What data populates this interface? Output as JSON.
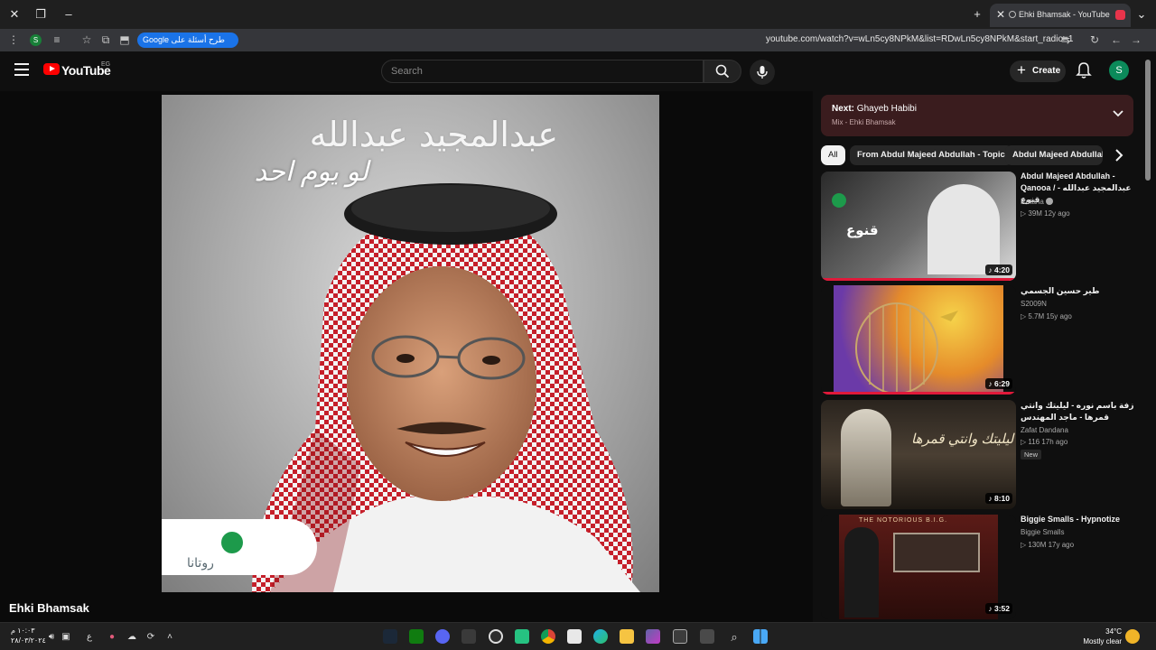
{
  "browser": {
    "tab_title": "Ehki Bhamsak - YouTube",
    "url": "youtube.com/watch?v=wLn5cy8NPkM&list=RDwLn5cy8NPkM&start_radio=1",
    "profile_initial": "S",
    "google_chip_label": "طرح أسئلة على Google"
  },
  "header": {
    "logo_text": "YouTube",
    "country_code": "EG",
    "search_placeholder": "Search",
    "create_label": "Create",
    "avatar_initial": "S"
  },
  "player": {
    "cover_artist_text": "عبدالمجيد عبدالله",
    "cover_title_text": "لو يوم احد",
    "cover_label_text": "روتانا",
    "channel_name": "Ehki Bhamsak"
  },
  "up_next": {
    "prefix": "Next:",
    "title": "Ghayeb Habibi",
    "subtitle": "Mix - Ehki Bhamsak"
  },
  "chips": [
    {
      "label": "All"
    },
    {
      "label": "From Abdul Majeed Abdullah - Topic"
    },
    {
      "label": "Abdul Majeed Abdullah"
    }
  ],
  "videos": [
    {
      "title": "Abdul Majeed Abdullah - Qanooa / عبدالمجيد عبدالله - قنوع",
      "channel": "Rotana",
      "meta": "39M  12y ago",
      "duration": "4:20",
      "thumb_text": "قنوع"
    },
    {
      "title": "طير   حسين الجسمي",
      "channel": "S2009N",
      "meta": "5.7M  15y ago",
      "duration": "6:29"
    },
    {
      "title": "زفة باسم نوره - ليليتك وانتي قمرها - ماجد المهندس",
      "channel": "Zafat Dandana",
      "meta": "116  17h ago",
      "badge": "New",
      "duration": "8:10",
      "thumb_text": "ليليتك وانتي قمرها"
    },
    {
      "title": "Biggie Smalls - Hypnotize",
      "channel": "Biggie Smalls",
      "meta": "130M  17y ago",
      "duration": "3:52",
      "thumb_text": "THE NOTORIOUS B.I.G."
    }
  ],
  "taskbar": {
    "time": "١٠:٠٣ م",
    "date": "٢٨/٠٣/٢٠٢٤",
    "lang": "ع",
    "temperature": "34°C",
    "weather_text": "Mostly clear"
  },
  "colors": {
    "youtube_red": "#ff0000",
    "next_box_bg": "#3a1c1e",
    "progress_red": "#e0193a"
  }
}
